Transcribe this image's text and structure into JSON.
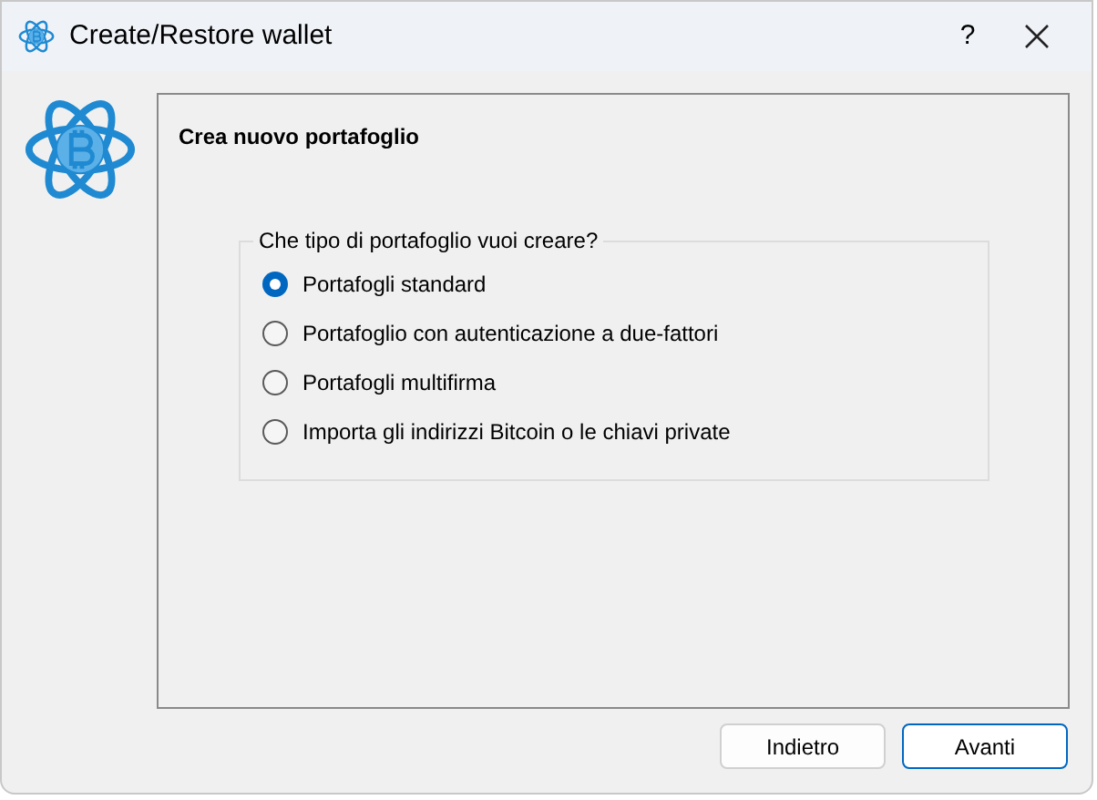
{
  "window": {
    "title": "Create/Restore wallet",
    "help": "?"
  },
  "page": {
    "heading": "Crea nuovo portafoglio"
  },
  "group": {
    "title": "Che tipo di portafoglio vuoi creare?",
    "options": [
      {
        "label": "Portafogli standard",
        "selected": true
      },
      {
        "label": "Portafoglio con autenticazione a due-fattori",
        "selected": false
      },
      {
        "label": "Portafogli multifirma",
        "selected": false
      },
      {
        "label": "Importa gli indirizzi Bitcoin o le chiavi private",
        "selected": false
      }
    ]
  },
  "buttons": [
    {
      "label": "Indietro",
      "default": false
    },
    {
      "label": "Avanti",
      "default": true
    }
  ]
}
